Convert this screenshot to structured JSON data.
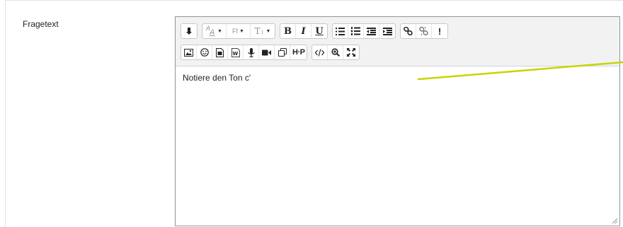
{
  "form": {
    "label": "Fragetext"
  },
  "toolbar": {
    "row1": [
      {
        "name": "accessibility-checker-button",
        "icon": "arrow-down-icon"
      },
      {
        "name": "font-color-button",
        "label": "A",
        "sub": "A",
        "icon": "font-color-icon"
      },
      {
        "name": "font-family-button",
        "label": "Ff",
        "icon": "font-family-icon"
      },
      {
        "name": "font-size-button",
        "label": "T",
        "icon": "font-size-icon"
      },
      {
        "name": "bold-button",
        "label": "B",
        "icon": "bold-icon"
      },
      {
        "name": "italic-button",
        "label": "I",
        "icon": "italic-icon"
      },
      {
        "name": "underline-button",
        "label": "U",
        "icon": "underline-icon"
      },
      {
        "name": "unordered-list-button",
        "icon": "bullet-list-icon"
      },
      {
        "name": "ordered-list-button",
        "icon": "numbered-list-icon"
      },
      {
        "name": "outdent-button",
        "icon": "outdent-icon"
      },
      {
        "name": "indent-button",
        "icon": "indent-icon"
      },
      {
        "name": "link-button",
        "icon": "link-icon"
      },
      {
        "name": "unlink-button",
        "icon": "unlink-icon"
      },
      {
        "name": "exclamation-button",
        "label": "!",
        "icon": "exclamation-icon"
      }
    ],
    "row2": [
      {
        "name": "image-button",
        "icon": "image-icon"
      },
      {
        "name": "emoji-button",
        "icon": "smiley-icon"
      },
      {
        "name": "media-button",
        "icon": "file-icon"
      },
      {
        "name": "word-import-button",
        "icon": "word-icon"
      },
      {
        "name": "record-audio-button",
        "icon": "microphone-icon"
      },
      {
        "name": "record-video-button",
        "icon": "video-camera-icon"
      },
      {
        "name": "manage-files-button",
        "icon": "copy-icon"
      },
      {
        "name": "h5p-button",
        "label": "H·P",
        "icon": "h5p-icon"
      },
      {
        "name": "html-button",
        "icon": "code-icon"
      },
      {
        "name": "zoom-button",
        "icon": "zoom-icon"
      },
      {
        "name": "fullscreen-button",
        "icon": "expand-icon"
      }
    ]
  },
  "editor": {
    "content": "Notiere den Ton c'"
  },
  "colors": {
    "toolbar_bg": "#f2f2f2",
    "annotation_line": "#c8d400",
    "border": "#8f959e"
  }
}
